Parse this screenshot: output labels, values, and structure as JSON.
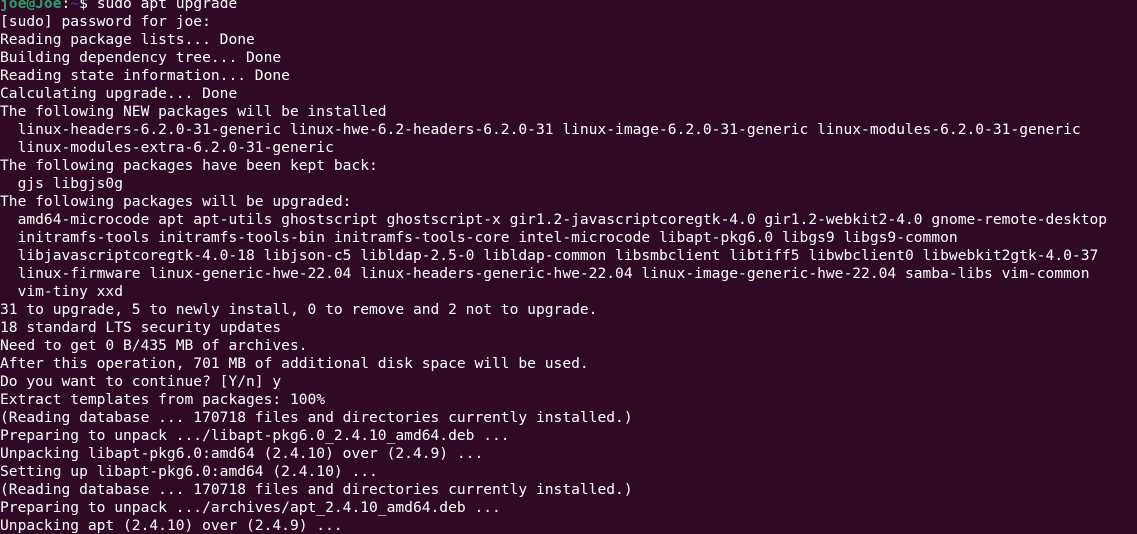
{
  "terminal": {
    "background": "#300a24",
    "foreground": "#ffffff",
    "prompt": {
      "user_host": "joe@Joe",
      "separator": ":",
      "path": "~",
      "symbol": "$ ",
      "command": "sudo apt upgrade",
      "user_color": "#26a269",
      "path_color": "#12488b"
    },
    "lines": [
      "[sudo] password for joe:",
      "Reading package lists... Done",
      "Building dependency tree... Done",
      "Reading state information... Done",
      "Calculating upgrade... Done",
      "The following NEW packages will be installed",
      "  linux-headers-6.2.0-31-generic linux-hwe-6.2-headers-6.2.0-31 linux-image-6.2.0-31-generic linux-modules-6.2.0-31-generic",
      "  linux-modules-extra-6.2.0-31-generic",
      "The following packages have been kept back:",
      "  gjs libgjs0g",
      "The following packages will be upgraded:",
      "  amd64-microcode apt apt-utils ghostscript ghostscript-x gir1.2-javascriptcoregtk-4.0 gir1.2-webkit2-4.0 gnome-remote-desktop",
      "  initramfs-tools initramfs-tools-bin initramfs-tools-core intel-microcode libapt-pkg6.0 libgs9 libgs9-common",
      "  libjavascriptcoregtk-4.0-18 libjson-c5 libldap-2.5-0 libldap-common libsmbclient libtiff5 libwbclient0 libwebkit2gtk-4.0-37",
      "  linux-firmware linux-generic-hwe-22.04 linux-headers-generic-hwe-22.04 linux-image-generic-hwe-22.04 samba-libs vim-common",
      "  vim-tiny xxd",
      "31 to upgrade, 5 to newly install, 0 to remove and 2 not to upgrade.",
      "18 standard LTS security updates",
      "Need to get 0 B/435 MB of archives.",
      "After this operation, 701 MB of additional disk space will be used.",
      "Do you want to continue? [Y/n] y",
      "Extract templates from packages: 100%",
      "(Reading database ... 170718 files and directories currently installed.)",
      "Preparing to unpack .../libapt-pkg6.0_2.4.10_amd64.deb ...",
      "Unpacking libapt-pkg6.0:amd64 (2.4.10) over (2.4.9) ...",
      "Setting up libapt-pkg6.0:amd64 (2.4.10) ...",
      "(Reading database ... 170718 files and directories currently installed.)",
      "Preparing to unpack .../archives/apt_2.4.10_amd64.deb ...",
      "Unpacking apt (2.4.10) over (2.4.9) ..."
    ]
  }
}
